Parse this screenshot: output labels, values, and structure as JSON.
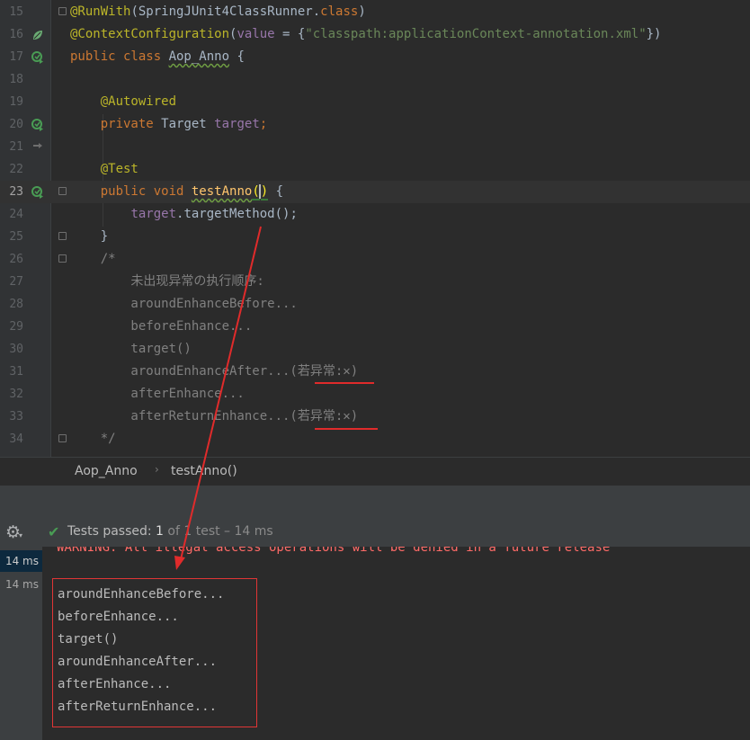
{
  "editor": {
    "lines": [
      {
        "num": "15",
        "parts": [
          {
            "t": "@RunWith",
            "c": "ann"
          },
          {
            "t": "(SpringJUnit4ClassRunner.",
            "c": ""
          },
          {
            "t": "class",
            "c": "kw"
          },
          {
            "t": ")",
            "c": ""
          }
        ]
      },
      {
        "num": "16",
        "parts": [
          {
            "t": "@ContextConfiguration",
            "c": "ann"
          },
          {
            "t": "(",
            "c": ""
          },
          {
            "t": "value",
            "c": "fld"
          },
          {
            "t": " = {",
            "c": ""
          },
          {
            "t": "\"classpath:applicationContext-annotation.xml\"",
            "c": "str"
          },
          {
            "t": "})",
            "c": ""
          }
        ]
      },
      {
        "num": "17",
        "parts": [
          {
            "t": "public class ",
            "c": "kw"
          },
          {
            "t": "Aop_Anno",
            "c": "typo"
          },
          {
            "t": " {",
            "c": ""
          }
        ]
      },
      {
        "num": "18",
        "parts": []
      },
      {
        "num": "19",
        "parts": [
          {
            "t": "    ",
            "c": ""
          },
          {
            "t": "@Autowired",
            "c": "ann"
          }
        ]
      },
      {
        "num": "20",
        "parts": [
          {
            "t": "    ",
            "c": ""
          },
          {
            "t": "private ",
            "c": "kw"
          },
          {
            "t": "Target ",
            "c": ""
          },
          {
            "t": "target",
            "c": "fld"
          },
          {
            "t": ";",
            "c": "kw"
          }
        ]
      },
      {
        "num": "21",
        "parts": []
      },
      {
        "num": "22",
        "parts": [
          {
            "t": "    ",
            "c": ""
          },
          {
            "t": "@Test",
            "c": "ann"
          }
        ]
      },
      {
        "num": "23",
        "parts": [
          {
            "t": "    ",
            "c": ""
          },
          {
            "t": "public void ",
            "c": "kw"
          },
          {
            "t": "testAnno",
            "c": "fn typo"
          },
          {
            "t": "(",
            "c": "brace-hl"
          },
          {
            "t": "",
            "c": "caret"
          },
          {
            "t": ")",
            "c": "brace-hl"
          },
          {
            "t": " {",
            "c": ""
          }
        ]
      },
      {
        "num": "24",
        "parts": [
          {
            "t": "        ",
            "c": ""
          },
          {
            "t": "target",
            "c": "fld"
          },
          {
            "t": ".targetMethod();",
            "c": ""
          }
        ]
      },
      {
        "num": "25",
        "parts": [
          {
            "t": "    }",
            "c": ""
          }
        ]
      },
      {
        "num": "26",
        "parts": [
          {
            "t": "    /*",
            "c": "cmt"
          }
        ]
      },
      {
        "num": "27",
        "parts": [
          {
            "t": "        未出现异常の执行顺序:",
            "c": "cmt"
          }
        ]
      },
      {
        "num": "28",
        "parts": [
          {
            "t": "        aroundEnhanceBefore...",
            "c": "cmt"
          }
        ]
      },
      {
        "num": "29",
        "parts": [
          {
            "t": "        beforeEnhance...",
            "c": "cmt"
          }
        ]
      },
      {
        "num": "30",
        "parts": [
          {
            "t": "        target()",
            "c": "cmt"
          }
        ]
      },
      {
        "num": "31",
        "parts": [
          {
            "t": "        aroundEnhanceAfter...(若异常:✕)",
            "c": "cmt"
          }
        ]
      },
      {
        "num": "32",
        "parts": [
          {
            "t": "        afterEnhance...",
            "c": "cmt"
          }
        ]
      },
      {
        "num": "33",
        "parts": [
          {
            "t": "        afterReturnEnhance...(若异常:✕)",
            "c": "cmt"
          }
        ]
      },
      {
        "num": "34",
        "parts": [
          {
            "t": "    */",
            "c": "cmt"
          }
        ]
      }
    ]
  },
  "breadcrumb": {
    "class_name": "Aop_Anno",
    "method_name": "testAnno()"
  },
  "run": {
    "status_prefix": "Tests passed: ",
    "passed_count": "1",
    "status_suffix": " of 1 test – 14 ms",
    "tree": [
      "14 ms",
      "14 ms"
    ]
  },
  "console": {
    "warning": "WARNING: All illegal access operations will be denied in a future release",
    "output": [
      "aroundEnhanceBefore...",
      "beforeEnhance...",
      "target()",
      "aroundEnhanceAfter...",
      "afterEnhance...",
      "afterReturnEnhance..."
    ]
  },
  "colors": {
    "keyword": "#cc7832",
    "annotation": "#bbb529",
    "string": "#6a8759",
    "field": "#9876aa",
    "comment": "#808080",
    "highlight_red": "#e02b2b",
    "pass_green": "#499c54"
  }
}
